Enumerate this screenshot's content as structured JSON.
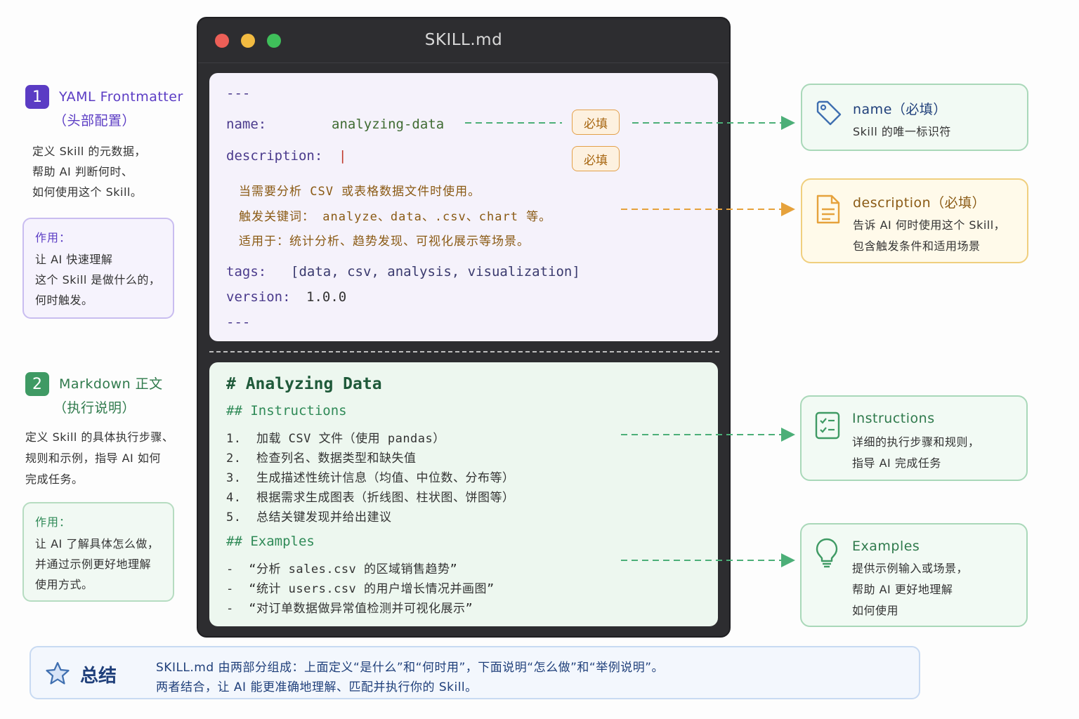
{
  "colors": {
    "purple": "#5b3cc4",
    "green": "#3f9a64",
    "orange": "#e6a23c",
    "blue": "#1f3f7a"
  },
  "left": {
    "yaml": {
      "num": "1",
      "title_1": "YAML Frontmatter",
      "title_2": "（头部配置）",
      "desc": "定义 Skill 的元数据，\n帮助 AI 判断何时、\n如何使用这个 Skill。",
      "note_head": "作用：",
      "note_body": "让 AI 快速理解\n这个 Skill 是做什么的，\n何时触发。"
    },
    "markdown": {
      "num": "2",
      "title_1": "Markdown 正文",
      "title_2": "（执行说明）",
      "desc": "定义 Skill 的具体执行步骤、\n规则和示例，指导 AI 如何\n完成任务。",
      "note_head": "作用：",
      "note_body": "让 AI 了解具体怎么做，\n并通过示例更好地理解\n使用方式。"
    }
  },
  "window": {
    "title": "SKILL.md",
    "yaml": {
      "open": "---",
      "name_key": "name:",
      "name_val": "analyzing-data",
      "desc_key": "description:",
      "desc_cursor": "|",
      "required": "必填",
      "desc_lines": [
        "当需要分析 CSV 或表格数据文件时使用。",
        "触发关键词： analyze、data、.csv、chart 等。",
        "适用于：统计分析、趋势发现、可视化展示等场景。"
      ],
      "tags_key": "tags:",
      "tags_val": "[data, csv, analysis, visualization]",
      "version_key": "version:",
      "version_val": "1.0.0",
      "close": "---"
    },
    "markdown": {
      "h1": "# Analyzing Data",
      "h2_instructions": "## Instructions",
      "steps": [
        "1.  加载 CSV 文件（使用 pandas）",
        "2.  检查列名、数据类型和缺失值",
        "3.  生成描述性统计信息（均值、中位数、分布等）",
        "4.  根据需求生成图表（折线图、柱状图、饼图等）",
        "5.  总结关键发现并给出建议"
      ],
      "h2_examples": "## Examples",
      "examples": [
        "-  “分析 sales.csv 的区域销售趋势”",
        "-  “统计 users.csv 的用户增长情况并画图”",
        "-  “对订单数据做异常值检测并可视化展示”"
      ]
    }
  },
  "cards": {
    "name": {
      "icon": "tag-icon",
      "title": "name（必填）",
      "text": "Skill 的唯一标识符"
    },
    "description": {
      "icon": "document-icon",
      "title": "description（必填）",
      "text": "告诉 AI 何时使用这个 Skill，\n包含触发条件和适用场景"
    },
    "instructions": {
      "icon": "checklist-icon",
      "title": "Instructions",
      "text": "详细的执行步骤和规则，\n指导 AI 完成任务"
    },
    "examples": {
      "icon": "lightbulb-icon",
      "title": "Examples",
      "text": "提供示例输入或场景，\n帮助 AI 更好地理解\n如何使用"
    }
  },
  "summary": {
    "icon": "star-icon",
    "title": "总结",
    "line1": "SKILL.md 由两部分组成：上面定义“是什么”和“何时用”，下面说明“怎么做”和“举例说明”。",
    "line2": "两者结合，让 AI 能更准确地理解、匹配并执行你的 Skill。"
  }
}
